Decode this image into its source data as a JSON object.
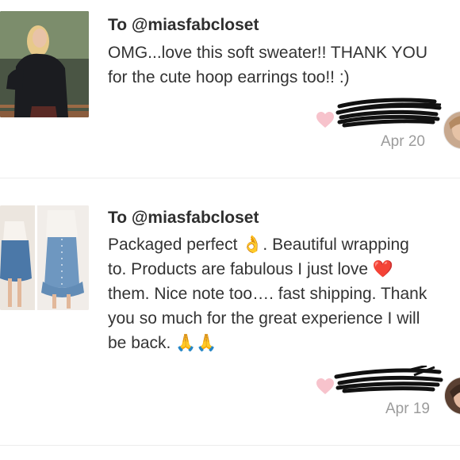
{
  "reviews": [
    {
      "recipient": "To @miasfabcloset",
      "text": "OMG...love this soft sweater!! THANK YOU\nfor the cute hoop earrings too!! :)",
      "reviewer": "",
      "date": "Apr 20",
      "thumb_icon": "woman-black-sweater-photo",
      "avatar_icon": "reviewer-avatar-photo"
    },
    {
      "recipient": "To @miasfabcloset",
      "text": "Packaged perfect 👌. Beautiful wrapping\nto. Products are fabulous I just love ❤️\nthem. Nice note too…. fast shipping. Thank\nyou so much for the great experience I will\nbe back. 🙏🙏",
      "reviewer": "",
      "date": "Apr 19",
      "thumb_icon": "denim-skirt-outfit-photos",
      "avatar_icon": "reviewer-avatar-photo"
    }
  ],
  "colors": {
    "heart": "#f7c3cc",
    "divider": "#ececec",
    "muted_text": "#9c9c9c",
    "redaction": "#111111"
  }
}
